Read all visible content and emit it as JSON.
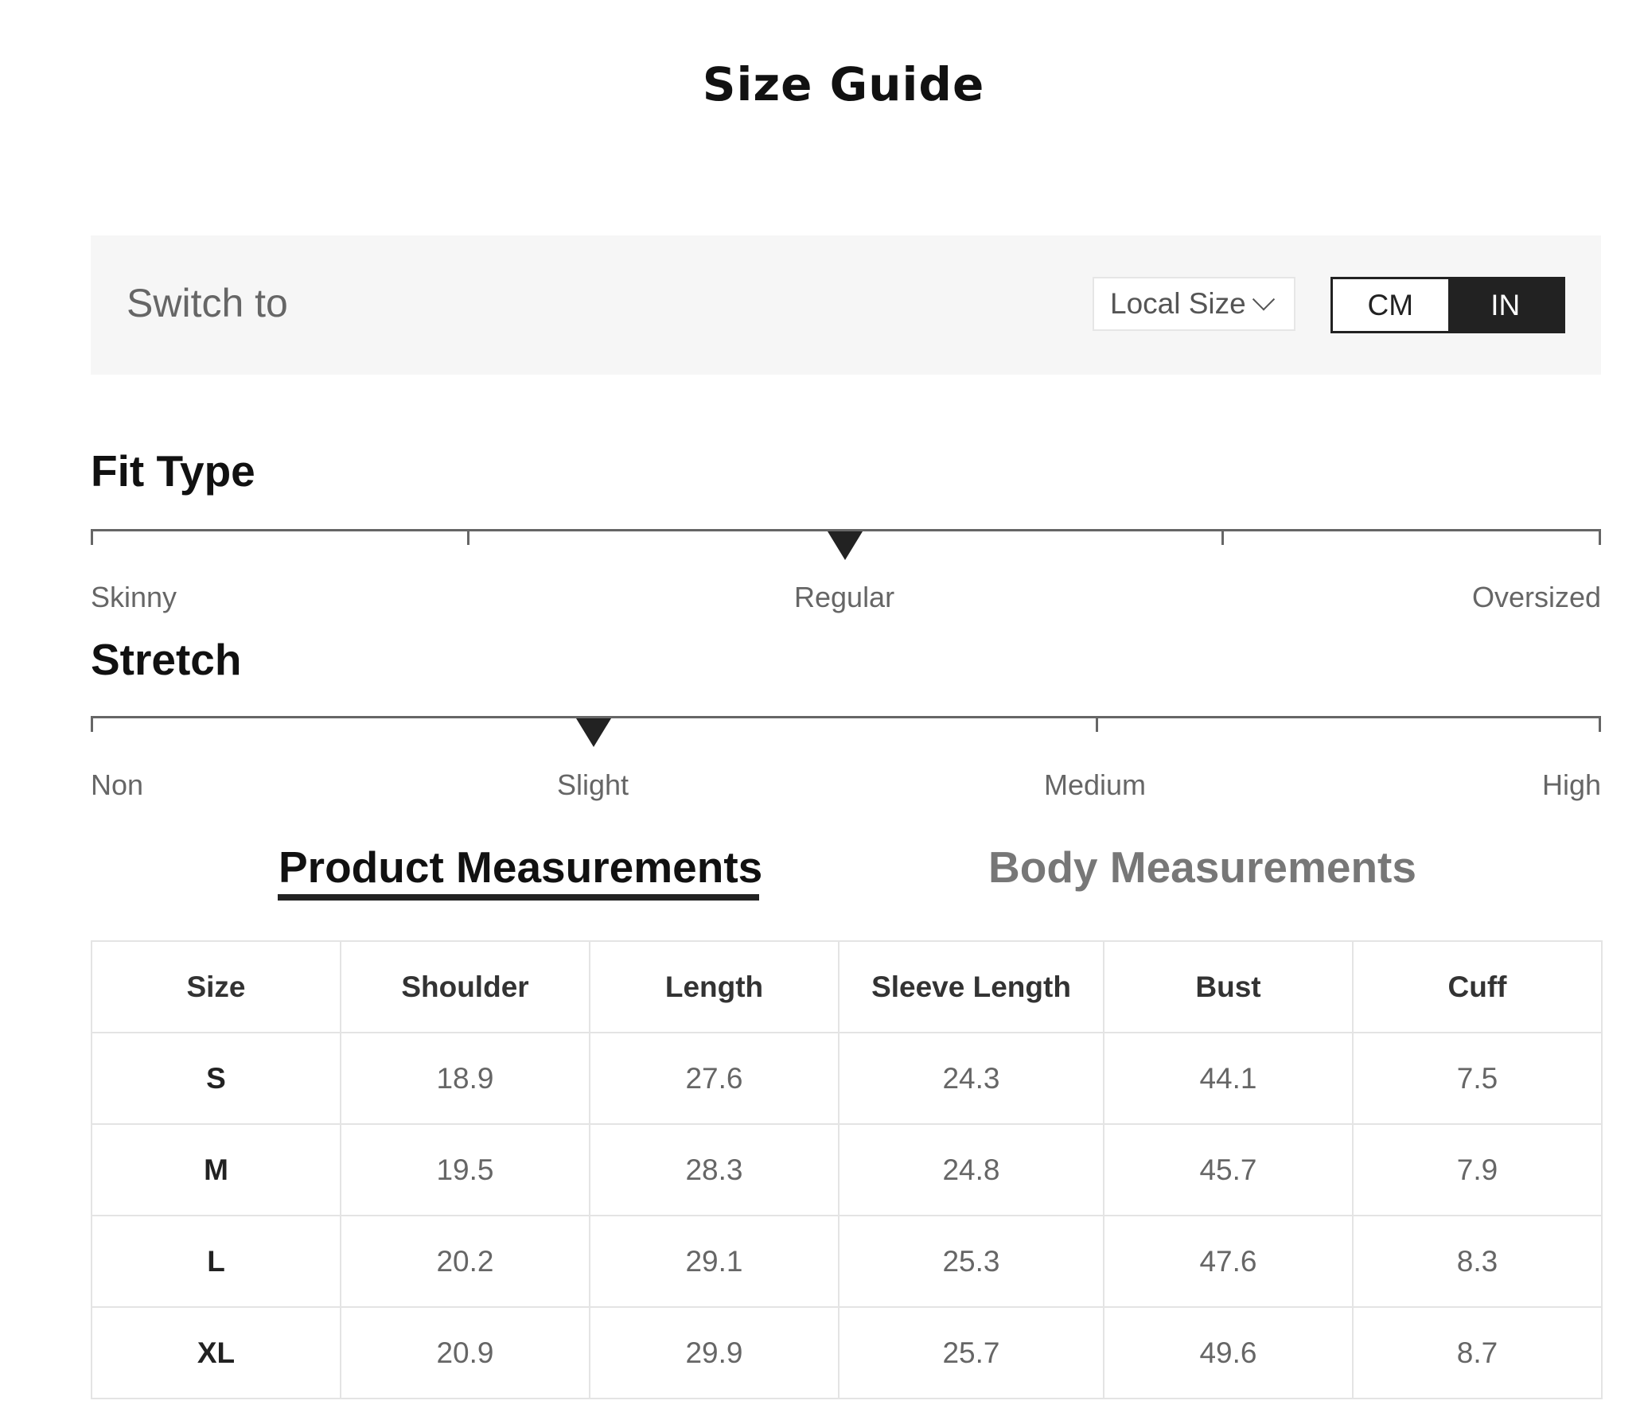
{
  "title": "Size Guide",
  "switch": {
    "label": "Switch to",
    "local_size": "Local Size",
    "units": [
      "CM",
      "IN"
    ],
    "selected_unit": "IN"
  },
  "fit_type": {
    "title": "Fit Type",
    "labels": [
      "Skinny",
      "Regular",
      "Oversized"
    ],
    "selected": "Regular"
  },
  "stretch": {
    "title": "Stretch",
    "labels": [
      "Non",
      "Slight",
      "Medium",
      "High"
    ],
    "selected": "Slight"
  },
  "tabs": [
    {
      "label": "Product Measurements",
      "active": true
    },
    {
      "label": "Body Measurements",
      "active": false
    }
  ],
  "table": {
    "headers": [
      "Size",
      "Shoulder",
      "Length",
      "Sleeve Length",
      "Bust",
      "Cuff"
    ],
    "rows": [
      [
        "S",
        "18.9",
        "27.6",
        "24.3",
        "44.1",
        "7.5"
      ],
      [
        "M",
        "19.5",
        "28.3",
        "24.8",
        "45.7",
        "7.9"
      ],
      [
        "L",
        "20.2",
        "29.1",
        "25.3",
        "47.6",
        "8.3"
      ],
      [
        "XL",
        "20.9",
        "29.9",
        "25.7",
        "49.6",
        "8.7"
      ]
    ]
  },
  "colors": {
    "accent": "#222222",
    "panel_bg": "#f6f6f6",
    "muted_text": "#666666",
    "inactive_tab": "#777777"
  }
}
